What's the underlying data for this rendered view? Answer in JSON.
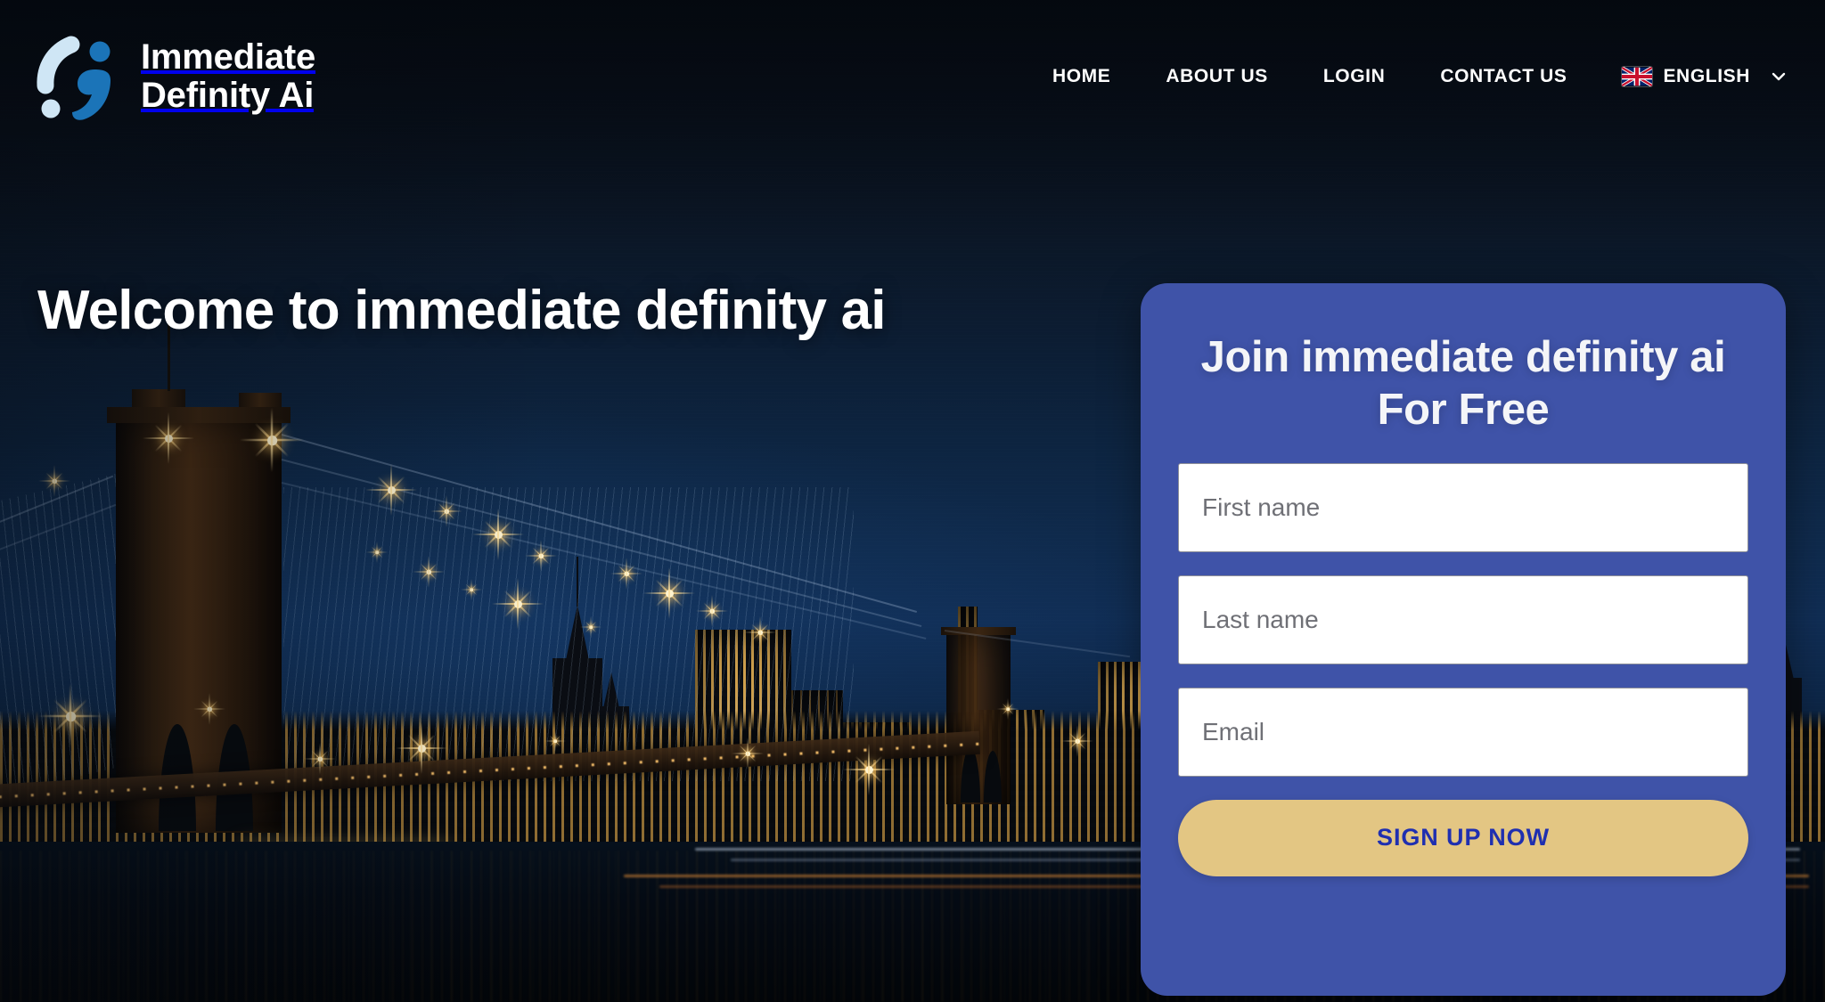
{
  "brand": {
    "name_line1": "Immediate",
    "name_line2": "Definity Ai",
    "logo_icon": "immediate-definity-ai-logomark",
    "logo_light_color": "#cfe6f5",
    "logo_blue_color": "#1b74b8"
  },
  "nav": {
    "items": [
      {
        "label": "HOME",
        "name": "nav-link-home"
      },
      {
        "label": "ABOUT US",
        "name": "nav-link-about-us"
      },
      {
        "label": "LOGIN",
        "name": "nav-link-login"
      },
      {
        "label": "CONTACT US",
        "name": "nav-link-contact-us"
      }
    ],
    "language": {
      "label": "ENGLISH",
      "flag_icon": "uk-flag-icon",
      "chevron_icon": "chevron-down-icon"
    }
  },
  "hero": {
    "title": "Welcome to immediate definity ai",
    "background_image": "new-york-city-skyline-brooklyn-bridge-at-night"
  },
  "signup": {
    "title": "Join immediate definity ai For Free",
    "fields": [
      {
        "name": "first-name-input",
        "placeholder": "First name",
        "value": ""
      },
      {
        "name": "last-name-input",
        "placeholder": "Last name",
        "value": ""
      },
      {
        "name": "email-input",
        "placeholder": "Email",
        "value": ""
      }
    ],
    "button_label": "SIGN UP NOW",
    "card_color": "#3f53a8",
    "button_color": "#e3c683",
    "button_text_color": "#1f2fb0"
  },
  "theme": {
    "page_background": "#0a1220",
    "text_color": "#ffffff"
  }
}
